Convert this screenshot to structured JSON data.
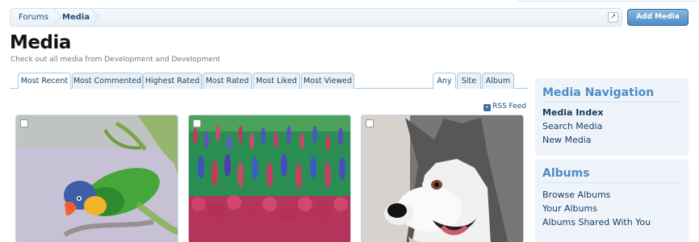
{
  "breadcrumbs": [
    "Forums",
    "Media"
  ],
  "popout_icon": "external-link-icon",
  "add_button": "Add Media",
  "page_title": "Media",
  "page_description": "Check out all media from Development and Development",
  "sort_tabs": [
    "Most Recent",
    "Most Commented",
    "Highest Rated",
    "Most Rated",
    "Most Liked",
    "Most Viewed"
  ],
  "scope_tabs": [
    "Any",
    "Site",
    "Album"
  ],
  "rss_link": "RSS Feed",
  "media_items": [
    {
      "name": "parrot-thumbnail"
    },
    {
      "name": "flowers-thumbnail"
    },
    {
      "name": "husky-thumbnail"
    }
  ],
  "sidebar": {
    "navigation": {
      "heading": "Media Navigation",
      "links": [
        "Media Index",
        "Search Media",
        "New Media"
      ]
    },
    "albums": {
      "heading": "Albums",
      "links": [
        "Browse Albums",
        "Your Albums",
        "Albums Shared With You"
      ]
    }
  },
  "colors": {
    "accent": "#4f8cc6",
    "link": "#173d61",
    "panel_bg": "#eef4fa",
    "tab_border": "#a5cae4"
  }
}
